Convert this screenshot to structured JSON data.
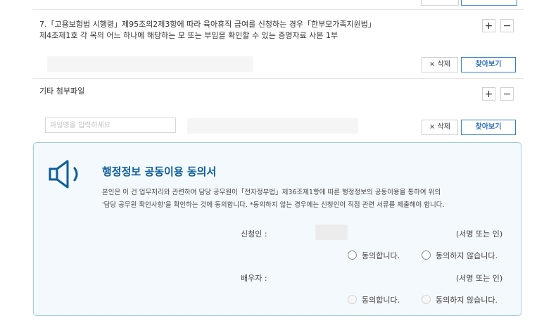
{
  "items": [
    {
      "text_line1": "7.「고용보험법 시행령」제95조의2제3항에 따라 육아휴직 급여를 신청하는 경우「한부모가족지원법」",
      "text_line2": "제4조제1호 각 목의 어느 하나에 해당하는 모 또는 부임을 확인할 수 있는 증명자료 사본 1부"
    },
    {
      "text_line1": "기타 첨부파일",
      "file_name_placeholder": "파일명을 입력하세요"
    }
  ],
  "buttons": {
    "add": "+",
    "remove": "−",
    "delete": "× 삭제",
    "find": "찾아보기"
  },
  "consent": {
    "icon": "speaker-icon",
    "title": "행정정보 공동이용 동의서",
    "desc_line1": "본인은 이 건 업무처리와 관련하여 담당 공무원이「전자정부법」제36조제1항에 따른 행정정보의 공동이용을 통하여 위의",
    "desc_line2": "'담당 공무원 확인사항'을 확인하는 것에 동의합니다. *동의하지 않는 경우에는 신청인이 직접 관련 서류를 제출해야 합니다.",
    "applicant_label": "신청인 :",
    "spouse_label": "배우자 :",
    "sign_text": "(서명 또는 인)",
    "agree_label": "동의합니다.",
    "disagree_label": "동의하지 않습니다."
  },
  "colors": {
    "accent": "#2f7fd0",
    "title": "#0d5e9c",
    "box_border": "#9fcbe8",
    "box_bg": "#f4f9fd"
  }
}
